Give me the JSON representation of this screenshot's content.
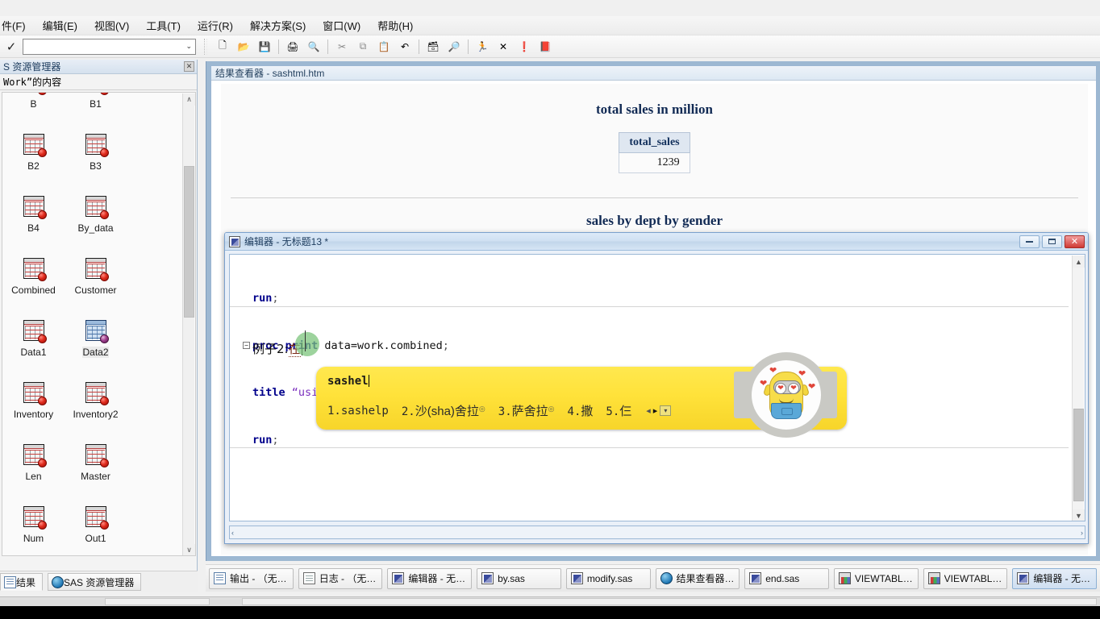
{
  "app": {
    "menu": [
      {
        "label": "件(F)",
        "name": "menu-file"
      },
      {
        "label": "编辑(E)",
        "name": "menu-edit"
      },
      {
        "label": "视图(V)",
        "name": "menu-view"
      },
      {
        "label": "工具(T)",
        "name": "menu-tools"
      },
      {
        "label": "运行(R)",
        "name": "menu-run"
      },
      {
        "label": "解决方案(S)",
        "name": "menu-solutions"
      },
      {
        "label": "窗口(W)",
        "name": "menu-window"
      },
      {
        "label": "帮助(H)",
        "name": "menu-help"
      }
    ],
    "toolbar": {
      "command_value": "",
      "command_caret": "⌄",
      "submit_glyph": "✓",
      "buttons": [
        {
          "name": "new-icon",
          "glyph": "🗋"
        },
        {
          "name": "open-folder-icon",
          "glyph": "📂"
        },
        {
          "name": "save-icon",
          "glyph": "💾"
        },
        {
          "name": "print-icon",
          "glyph": "🖨"
        },
        {
          "name": "print-preview-icon",
          "glyph": "🔍"
        },
        {
          "name": "cut-icon",
          "glyph": "✂"
        },
        {
          "name": "copy-icon",
          "glyph": "⧉"
        },
        {
          "name": "paste-icon",
          "glyph": "📋"
        },
        {
          "name": "undo-icon",
          "glyph": "↶"
        },
        {
          "name": "new-library-icon",
          "glyph": "🗃"
        },
        {
          "name": "explorer-icon",
          "glyph": "🔎"
        },
        {
          "name": "run-icon",
          "glyph": "🏃"
        },
        {
          "name": "stop-icon",
          "glyph": "✕"
        },
        {
          "name": "help-icon",
          "glyph": "❗"
        },
        {
          "name": "about-icon",
          "glyph": "📕"
        }
      ]
    }
  },
  "explorer": {
    "title": "S 资源管理器",
    "close_glyph": "✕",
    "path_label": "Work”的内容",
    "scroll_up": "∧",
    "scroll_down": "∨",
    "items": [
      {
        "label": "B",
        "selected": false,
        "kind": "dataset"
      },
      {
        "label": "B1",
        "selected": false,
        "kind": "dataset"
      },
      {
        "label": "B2",
        "selected": false,
        "kind": "dataset"
      },
      {
        "label": "B3",
        "selected": false,
        "kind": "dataset"
      },
      {
        "label": "B4",
        "selected": false,
        "kind": "dataset"
      },
      {
        "label": "By_data",
        "selected": false,
        "kind": "dataset"
      },
      {
        "label": "Combined",
        "selected": false,
        "kind": "dataset"
      },
      {
        "label": "Customer",
        "selected": false,
        "kind": "dataset"
      },
      {
        "label": "Data1",
        "selected": false,
        "kind": "dataset"
      },
      {
        "label": "Data2",
        "selected": true,
        "kind": "dataset-selected"
      },
      {
        "label": "Inventory",
        "selected": false,
        "kind": "dataset"
      },
      {
        "label": "Inventory2",
        "selected": false,
        "kind": "dataset"
      },
      {
        "label": "Len",
        "selected": false,
        "kind": "dataset"
      },
      {
        "label": "Master",
        "selected": false,
        "kind": "dataset"
      },
      {
        "label": "Num",
        "selected": false,
        "kind": "dataset"
      },
      {
        "label": "Out1",
        "selected": false,
        "kind": "dataset"
      }
    ],
    "tabs": [
      {
        "label": "结果",
        "active": true,
        "icon": "results-icon"
      },
      {
        "label": "SAS 资源管理器",
        "active": false,
        "icon": "explorer-icon"
      }
    ]
  },
  "results_viewer": {
    "title": "结果查看器 - sashtml.htm",
    "report": {
      "title_1": "total sales in million",
      "table_1": {
        "header": "total_sales",
        "value": "1239"
      },
      "title_2": "sales by dept by gender"
    }
  },
  "editor": {
    "title": "编辑器 - 无标题13 *",
    "window_buttons": {
      "minimize": "—",
      "restore": "□",
      "close": "✕"
    },
    "fold_glyph": "−",
    "lines": [
      {
        "kw": "run",
        "pn": ";",
        "rest": ""
      },
      {
        "kw": "proc print",
        "id": " data=work.combined",
        "pn": ";",
        "fold": true
      },
      {
        "kw": "title",
        "st": " “using two set in data step”",
        "pn": ";"
      },
      {
        "kw": "run",
        "pn": ";"
      }
    ],
    "chinese_line": {
      "prefix": "例子2:",
      "composing": "在"
    },
    "hscroll_left": "‹",
    "hscroll_right": "›"
  },
  "ime": {
    "composition": "sashel",
    "candidates": [
      {
        "num": "1.",
        "text": "sashelp",
        "type": "en"
      },
      {
        "num": "2.",
        "text": "沙(sha)舍拉",
        "type": "cn",
        "pinyin": "(sha)",
        "mark": "◎"
      },
      {
        "num": "3.",
        "text": "萨舍拉",
        "type": "cn",
        "mark": "◎"
      },
      {
        "num": "4.",
        "text": "撒",
        "type": "cn"
      },
      {
        "num": "5.",
        "text": "仨",
        "type": "cn"
      }
    ],
    "nav": {
      "prev": "◂",
      "next": "▸",
      "menu": "▾"
    },
    "mascot": "minion-mascot"
  },
  "taskbar": {
    "buttons": [
      {
        "label": "输出 - （无标...",
        "icon": "output-icon",
        "active": false
      },
      {
        "label": "日志 - （无标...",
        "icon": "log-icon",
        "active": false
      },
      {
        "label": "编辑器 - 无标...",
        "icon": "sas-editor-icon",
        "active": false
      },
      {
        "label": "by.sas",
        "icon": "sas-editor-icon",
        "active": false
      },
      {
        "label": "modify.sas",
        "icon": "sas-editor-icon",
        "active": false
      },
      {
        "label": "结果查看器 - ...",
        "icon": "globe-icon",
        "active": false
      },
      {
        "label": "end.sas",
        "icon": "sas-editor-icon",
        "active": false
      },
      {
        "label": "VIEWTABLE: ...",
        "icon": "viewtable-icon",
        "active": false
      },
      {
        "label": "VIEWTABLE: ...",
        "icon": "viewtable-icon",
        "active": false
      },
      {
        "label": "编辑器 - 无标...",
        "icon": "sas-editor-icon",
        "active": true
      }
    ]
  }
}
